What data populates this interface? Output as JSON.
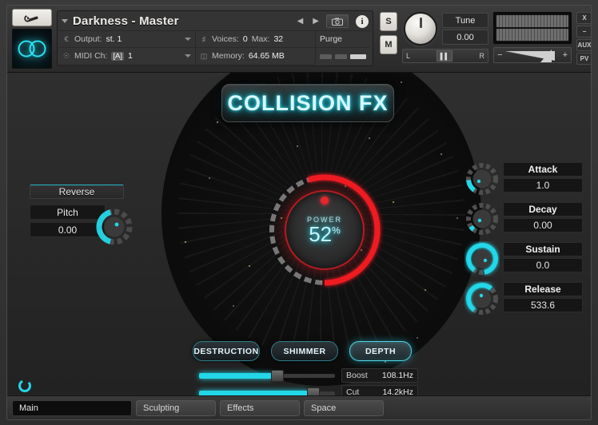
{
  "header": {
    "wrench_icon": "wrench-icon",
    "logo_icon": "infinity-logo-icon",
    "instrument_name": "Darkness - Master",
    "prev_arrow": "◀",
    "next_arrow": "▶",
    "camera_icon": "camera-icon",
    "info_icon": "i",
    "output_label": "Output:",
    "output_value": "st. 1",
    "midi_label": "MIDI Ch:",
    "midi_bank": "[A]",
    "midi_value": "1",
    "voices_label": "Voices:",
    "voices_value": "0",
    "max_label": "Max:",
    "max_value": "32",
    "memory_label": "Memory:",
    "memory_value": "64.65 MB",
    "purge_label": "Purge",
    "solo_label": "S",
    "mute_label": "M",
    "tune_label": "Tune",
    "tune_value": "0.00",
    "pan_left": "L",
    "pan_right": "R",
    "vol_minus": "−",
    "vol_plus": "+",
    "win_close": "X",
    "win_minimize": "−",
    "win_aux": "AUX",
    "win_pv": "PV"
  },
  "stage": {
    "title": "COLLISION FX",
    "power": {
      "label": "POWER",
      "value": "52",
      "unit": "%",
      "percent": 52
    }
  },
  "left": {
    "reverse_label": "Reverse",
    "pitch_label": "Pitch",
    "pitch_value": "0.00"
  },
  "envelope": {
    "rows": [
      {
        "name": "Attack",
        "value": "1.0",
        "fill": 20
      },
      {
        "name": "Decay",
        "value": "0.00",
        "fill": 8
      },
      {
        "name": "Sustain",
        "value": "0.0",
        "fill": 92
      },
      {
        "name": "Release",
        "value": "533.6",
        "fill": 62
      }
    ]
  },
  "fx_buttons": [
    {
      "label": "DESTRUCTION",
      "active": false
    },
    {
      "label": "SHIMMER",
      "active": false
    },
    {
      "label": "DEPTH",
      "active": true
    }
  ],
  "eq": {
    "boost_label": "Boost",
    "boost_value": "108.1Hz",
    "boost_percent": 55,
    "cut_label": "Cut",
    "cut_value": "14.2kHz",
    "cut_percent": 82
  },
  "tabs": [
    {
      "label": "Main",
      "active": true
    },
    {
      "label": "Sculpting",
      "active": false
    },
    {
      "label": "Effects",
      "active": false
    },
    {
      "label": "Space",
      "active": false
    }
  ],
  "colors": {
    "accent_cyan": "#23d7e8",
    "power_red": "#e8252c",
    "panel_dark": "#232323"
  }
}
